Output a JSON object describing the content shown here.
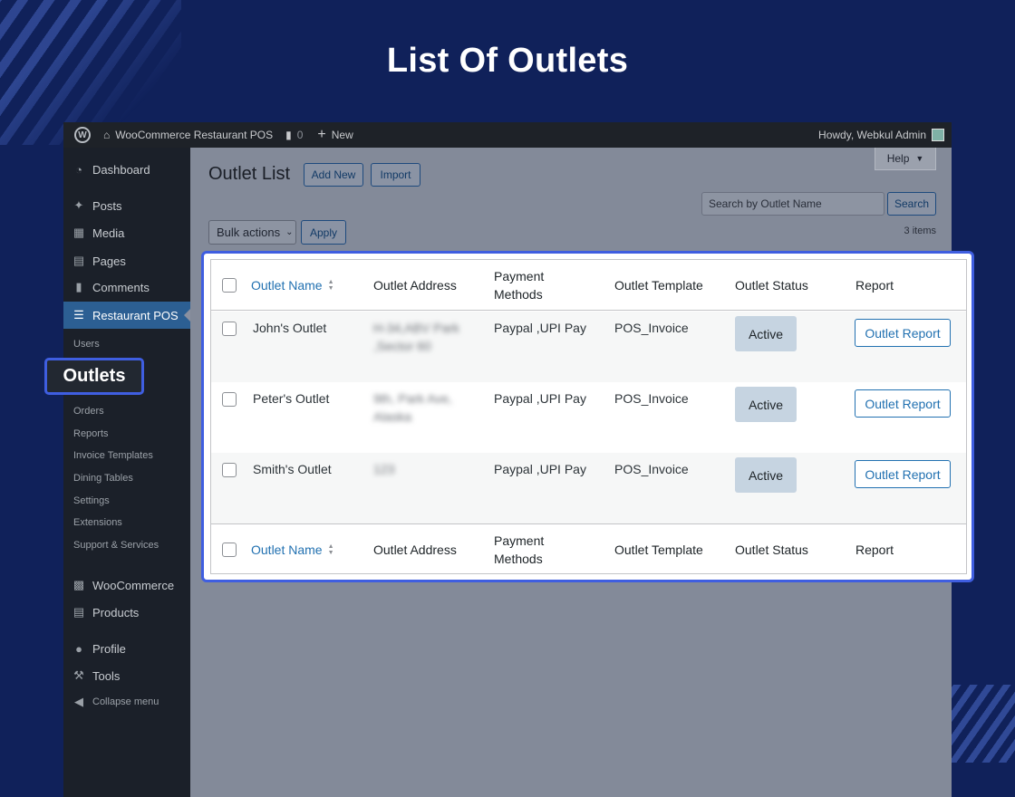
{
  "hero": {
    "title": "List Of Outlets"
  },
  "adminbar": {
    "site_name": "WooCommerce Restaurant POS",
    "comments_count": "0",
    "new_label": "New",
    "greeting": "Howdy, Webkul Admin"
  },
  "sidebar": {
    "items": [
      {
        "label": "Dashboard",
        "icon": "dashboard-icon"
      },
      {
        "label": "Posts",
        "icon": "pin-icon"
      },
      {
        "label": "Media",
        "icon": "media-icon"
      },
      {
        "label": "Pages",
        "icon": "pages-icon"
      },
      {
        "label": "Comments",
        "icon": "comment-icon"
      },
      {
        "label": "Restaurant POS",
        "icon": "cutlery-icon",
        "current": true
      },
      {
        "label": "WooCommerce",
        "icon": "woo-icon"
      },
      {
        "label": "Products",
        "icon": "archive-icon"
      },
      {
        "label": "Profile",
        "icon": "user-icon"
      },
      {
        "label": "Tools",
        "icon": "wrench-icon"
      },
      {
        "label": "Collapse menu",
        "icon": "collapse-icon"
      }
    ],
    "submenu": [
      "Users",
      "Outlets",
      "Orders",
      "Reports",
      "Invoice Templates",
      "Dining Tables",
      "Settings",
      "Extensions",
      "Support & Services"
    ]
  },
  "page": {
    "help_label": "Help",
    "title": "Outlet List",
    "add_new_label": "Add New",
    "import_label": "Import",
    "search_placeholder": "Search by Outlet Name",
    "search_button": "Search",
    "bulk_actions_label": "Bulk actions",
    "apply_label": "Apply",
    "items_count": "3 items"
  },
  "table": {
    "columns": [
      "Outlet Name",
      "Outlet Address",
      "Payment Methods",
      "Outlet Template",
      "Outlet Status",
      "Report"
    ],
    "rows": [
      {
        "name": "John's Outlet",
        "address": "H-34,ABV Park ,Sector 60",
        "payment": "Paypal ,UPI Pay",
        "template": "POS_Invoice",
        "status": "Active",
        "report": "Outlet Report"
      },
      {
        "name": "Peter's Outlet",
        "address": "9th, Park Ave, Alaska",
        "payment": "Paypal ,UPI Pay",
        "template": "POS_Invoice",
        "status": "Active",
        "report": "Outlet Report"
      },
      {
        "name": "Smith's Outlet",
        "address": "123",
        "payment": "Paypal ,UPI Pay",
        "template": "POS_Invoice",
        "status": "Active",
        "report": "Outlet Report"
      }
    ]
  }
}
